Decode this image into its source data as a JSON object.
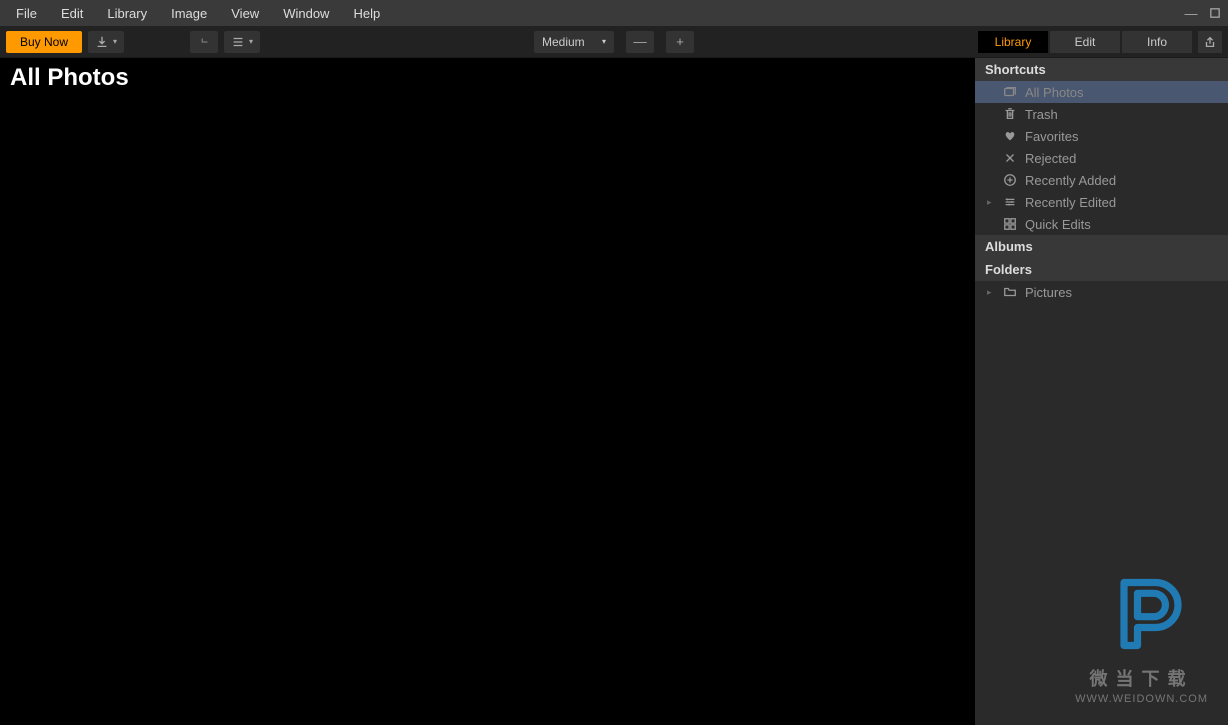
{
  "menubar": {
    "items": [
      "File",
      "Edit",
      "Library",
      "Image",
      "View",
      "Window",
      "Help"
    ]
  },
  "toolbar": {
    "buy_label": "Buy Now",
    "size_label": "Medium",
    "tabs": [
      "Library",
      "Edit",
      "Info"
    ],
    "active_tab": 0
  },
  "main": {
    "title": "All Photos"
  },
  "sidebar": {
    "shortcuts_header": "Shortcuts",
    "albums_header": "Albums",
    "folders_header": "Folders",
    "shortcuts": [
      {
        "label": "All Photos",
        "icon": "stack",
        "selected": true
      },
      {
        "label": "Trash",
        "icon": "trash"
      },
      {
        "label": "Favorites",
        "icon": "heart"
      },
      {
        "label": "Rejected",
        "icon": "x"
      },
      {
        "label": "Recently Added",
        "icon": "plus-circle"
      },
      {
        "label": "Recently Edited",
        "icon": "sliders",
        "expandable": true
      },
      {
        "label": "Quick Edits",
        "icon": "grid"
      }
    ],
    "folders": [
      {
        "label": "Pictures",
        "icon": "folder",
        "expandable": true
      }
    ]
  },
  "watermark": {
    "text": "微当下载",
    "url": "WWW.WEIDOWN.COM"
  }
}
